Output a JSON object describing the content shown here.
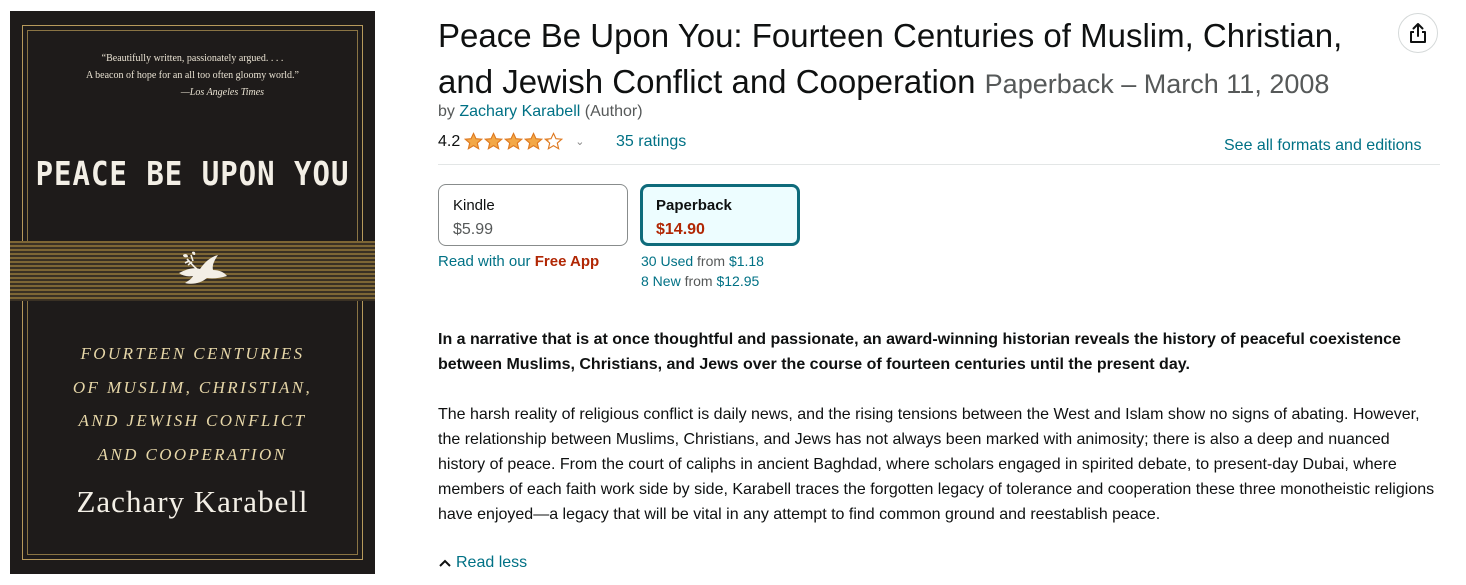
{
  "cover": {
    "quote_lines": [
      "“Beautifully written, passionately argued. . . .",
      "A beacon of hope for an all too often gloomy world.”"
    ],
    "quote_attribution": "—Los Angeles Times",
    "title": "PEACE BE UPON YOU",
    "subtitle_lines": [
      "FOURTEEN CENTURIES",
      "OF MUSLIM, CHRISTIAN,",
      "AND JEWISH CONFLICT",
      "AND COOPERATION"
    ],
    "author": "Zachary Karabell",
    "colors": {
      "background": "#1e1b1a",
      "gold": "#b79a5c"
    }
  },
  "product": {
    "title": "Peace Be Upon You: Fourteen Centuries of Muslim, Christian, and Jewish Conflict and Cooperation",
    "format_date": "Paperback – March 11, 2008",
    "by_prefix": "by",
    "author_name": "Zachary Karabell",
    "author_role": "(Author)",
    "rating_value": "4.2",
    "rating_stars": 4.2,
    "ratings_count": "35 ratings",
    "see_all_formats": "See all formats and editions"
  },
  "formats": {
    "kindle": {
      "name": "Kindle",
      "price": "$5.99",
      "read_prefix": "Read with our",
      "free_app": "Free App"
    },
    "paperback": {
      "name": "Paperback",
      "price": "$14.90",
      "selected": true
    },
    "offers": [
      {
        "label": "30 Used",
        "from": "from",
        "price": "$1.18"
      },
      {
        "label": "8 New",
        "from": "from",
        "price": "$12.95"
      }
    ]
  },
  "description": {
    "lead": "In a narrative that is at once thoughtful and passionate, an award-winning historian reveals the history of peaceful coexistence between Muslims, Christians, and Jews over the course of fourteen centuries until the present day.",
    "body": "The harsh reality of religious conflict is daily news, and the rising tensions between the West and Islam show no signs of abating. However, the relationship between Muslims, Christians, and Jews has not always been marked with animosity; there is also a deep and nuanced history of peace. From the court of caliphs in ancient Baghdad, where scholars engaged in spirited debate, to present-day Dubai, where members of each faith work side by side, Karabell traces the forgotten legacy of tolerance and cooperation these three monotheistic religions have enjoyed—a legacy that will be vital in any attempt to find common ground and reestablish peace.",
    "read_less": "Read less"
  },
  "icons": {
    "share": "share-icon",
    "star": "star-icon",
    "chevron": "chevron-down-icon",
    "caret_up": "chevron-up-icon"
  },
  "colors": {
    "link": "#007185",
    "price_red": "#b12704",
    "star": "#f3a847",
    "selected_border": "#0e6b7b"
  }
}
